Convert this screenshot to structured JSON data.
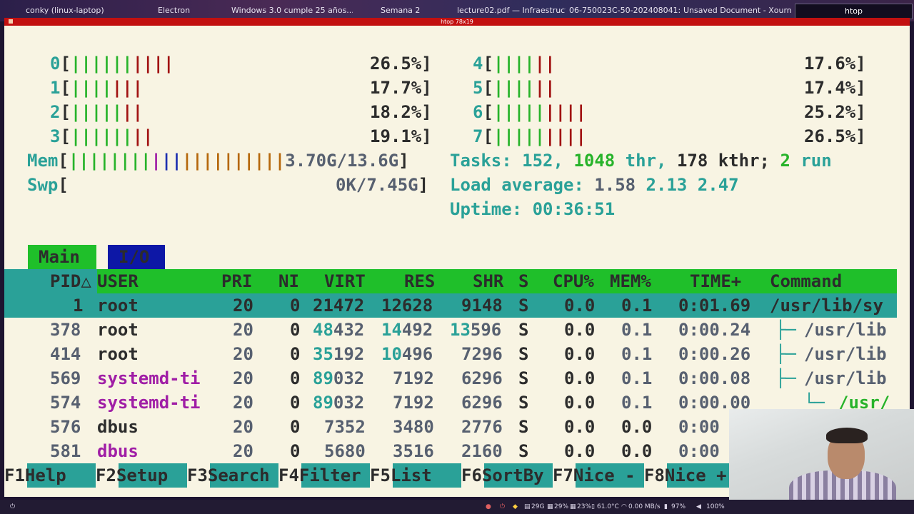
{
  "taskbar": {
    "items": [
      "conky (linux-laptop)",
      "Electron",
      "Windows 3.0 cumple 25 años...",
      "Semana 2",
      "lecture02.pdf — Infraestructu...",
      "06-750023C-50-202408041: Pl...",
      "Unsaved Document - Xourna..."
    ],
    "active": "htop"
  },
  "window": {
    "title": "htop 78x19"
  },
  "cpu": [
    {
      "id": "0",
      "green": "||||||",
      "red": "||||",
      "pct": "26.5%"
    },
    {
      "id": "1",
      "green": "||||",
      "red": "|||",
      "pct": "17.7%"
    },
    {
      "id": "2",
      "green": "|||||",
      "red": "||",
      "pct": "18.2%"
    },
    {
      "id": "3",
      "green": "||||||",
      "red": "||",
      "pct": "19.1%"
    },
    {
      "id": "4",
      "green": "||||",
      "red": "||",
      "pct": "17.6%"
    },
    {
      "id": "5",
      "green": "||||",
      "red": "||",
      "pct": "17.4%"
    },
    {
      "id": "6",
      "green": "|||||",
      "red": "||||",
      "pct": "25.2%"
    },
    {
      "id": "7",
      "green": "|||||",
      "red": "||||",
      "pct": "26.5%"
    }
  ],
  "mem": {
    "label": "Mem",
    "green": "||||||||",
    "mag": "|",
    "blue": "||",
    "orange": "||||||||||",
    "value": "3.70G/13.6G"
  },
  "swp": {
    "label": "Swp",
    "value": "0K/7.45G"
  },
  "tasks": {
    "label": "Tasks:",
    "count": "152",
    "thr": "1048",
    "thr_label": "thr",
    "kthr": "178",
    "kthr_label": "kthr;",
    "run": "2",
    "run_label": "run"
  },
  "load": {
    "label": "Load average:",
    "v1": "1.58",
    "v2": "2.13",
    "v3": "2.47"
  },
  "uptime": {
    "label": "Uptime:",
    "value": "00:36:51"
  },
  "tabs": {
    "main": "Main",
    "io": "I/O"
  },
  "columns": {
    "pid": "PID△",
    "user": "USER",
    "pri": "PRI",
    "ni": "NI",
    "virt": "VIRT",
    "res": "RES",
    "shr": "SHR",
    "s": "S",
    "cpu": "CPU%",
    "mem": "MEM%",
    "time": "TIME+",
    "command": "Command"
  },
  "rows": [
    {
      "pid": "1",
      "user": "root",
      "pri": "20",
      "ni": "0",
      "virt": "21472",
      "res": "12628",
      "shr": "9148",
      "s": "S",
      "cpu": "0.0",
      "mem": "0.1",
      "time": "0:01.69",
      "cmd": "/usr/lib/sy"
    },
    {
      "pid": "378",
      "user": "root",
      "pri": "20",
      "ni": "0",
      "virt_hi": "48",
      "virt_lo": "432",
      "res_hi": "14",
      "res_lo": "492",
      "shr_hi": "13",
      "shr_lo": "596",
      "s": "S",
      "cpu": "0.0",
      "mem": "0.1",
      "time": "0:00.24",
      "tree": "├─",
      "cmd": "/usr/lib"
    },
    {
      "pid": "414",
      "user": "root",
      "pri": "20",
      "ni": "0",
      "virt_hi": "35",
      "virt_lo": "192",
      "res_hi": "10",
      "res_lo": "496",
      "shr": "7296",
      "s": "S",
      "cpu": "0.0",
      "mem": "0.1",
      "time": "0:00.26",
      "tree": "├─",
      "cmd": "/usr/lib"
    },
    {
      "pid": "569",
      "user": "systemd-ti",
      "pri": "20",
      "ni": "0",
      "virt_hi": "89",
      "virt_lo": "032",
      "res": "7192",
      "shr": "6296",
      "s": "S",
      "cpu": "0.0",
      "mem": "0.1",
      "time": "0:00.08",
      "tree": "├─",
      "cmd": "/usr/lib"
    },
    {
      "pid": "574",
      "user": "systemd-ti",
      "pri": "20",
      "ni": "0",
      "virt_hi": "89",
      "virt_lo": "032",
      "res": "7192",
      "shr": "6296",
      "s": "S",
      "cpu": "0.0",
      "mem": "0.1",
      "time": "0:00.00",
      "tree": "└─",
      "cmd": "/usr/"
    },
    {
      "pid": "576",
      "user": "dbus",
      "pri": "20",
      "ni": "0",
      "virt": "7352",
      "res": "3480",
      "shr": "2776",
      "s": "S",
      "cpu": "0.0",
      "mem": "0.0",
      "time": "0:00"
    },
    {
      "pid": "581",
      "user": "dbus",
      "pri": "20",
      "ni": "0",
      "virt": "5680",
      "res": "3516",
      "shr": "2160",
      "s": "S",
      "cpu": "0.0",
      "mem": "0.0",
      "time": "0:00"
    }
  ],
  "fkeys": [
    {
      "key": "F1",
      "label": "Help"
    },
    {
      "key": "F2",
      "label": "Setup"
    },
    {
      "key": "F3",
      "label": "Search"
    },
    {
      "key": "F4",
      "label": "Filter"
    },
    {
      "key": "F5",
      "label": "List"
    },
    {
      "key": "F6",
      "label": "SortBy"
    },
    {
      "key": "F7",
      "label": "Nice -"
    },
    {
      "key": "F8",
      "label": "Nice +"
    }
  ],
  "statusbar": {
    "disk": "29G",
    "cpu": "29%",
    "mem": "23%",
    "temp": "61.0°C",
    "net": "0.00 MB/s",
    "battery": "97%",
    "volume": "100%"
  }
}
